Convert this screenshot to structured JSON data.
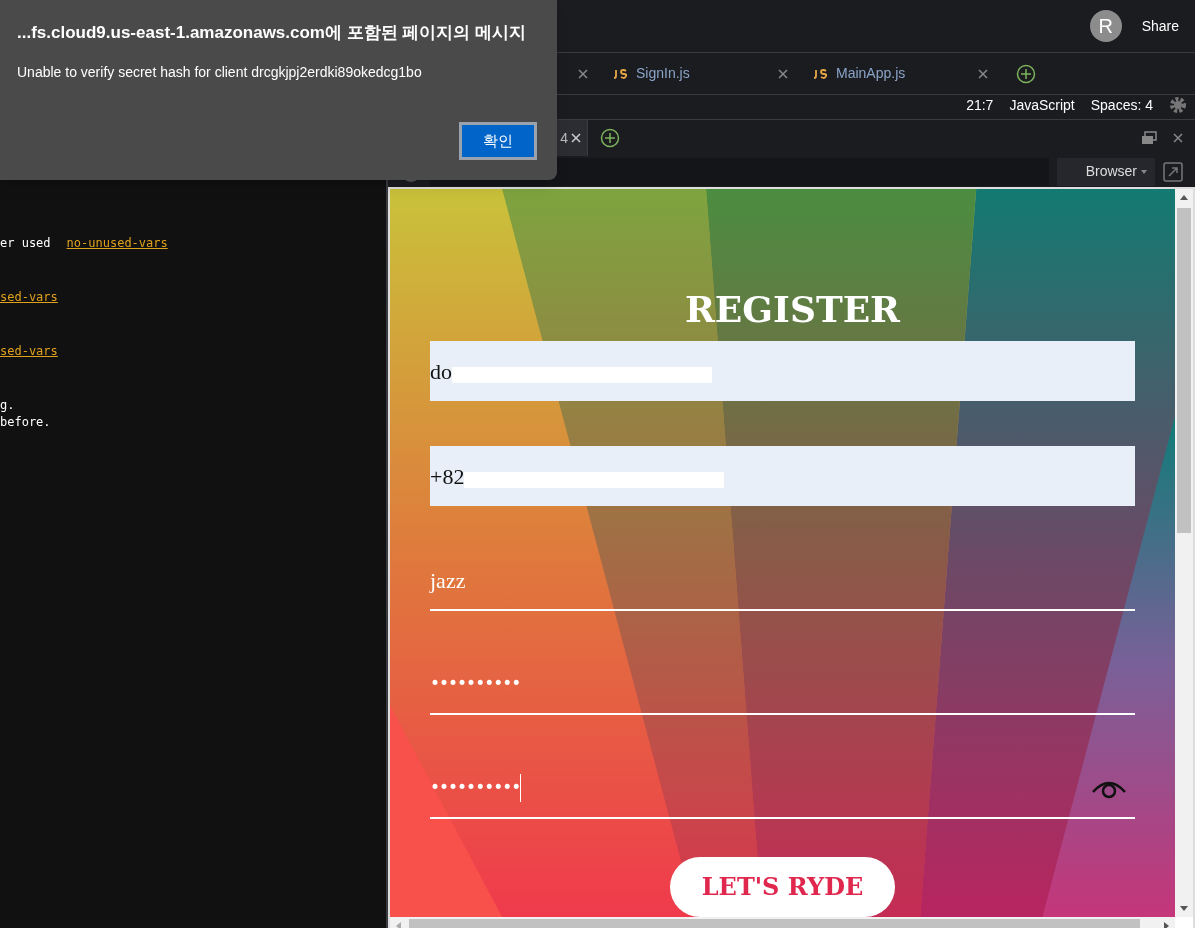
{
  "top_bar": {
    "avatar": "R",
    "share": "Share"
  },
  "editor_tabs": [
    {
      "selected": false
    },
    {
      "label": "SignIn.js",
      "selected": false
    },
    {
      "label": "MainApp.js",
      "selected": false
    }
  ],
  "status_bar": {
    "position": "21:7",
    "language": "JavaScript",
    "indent": "Spaces: 4"
  },
  "console_lines": [
    {
      "text": "er used",
      "link": "no-unused-vars"
    },
    {
      "link": "sed-vars"
    },
    {
      "link": "sed-vars"
    },
    {
      "text": "g."
    },
    {
      "text": "before."
    }
  ],
  "preview_tabs": [
    {
      "label": "4",
      "selected": true
    }
  ],
  "browser_bar": {
    "mode": "Browser"
  },
  "form": {
    "title": "REGISTER",
    "fields": [
      {
        "kind": "filled",
        "value": "do",
        "redacted": true
      },
      {
        "kind": "filled",
        "value": "+82",
        "redacted": true
      },
      {
        "kind": "line",
        "value": "jazz"
      },
      {
        "kind": "password",
        "value": "••••••••••"
      },
      {
        "kind": "password",
        "value": "••••••••••",
        "focused": true,
        "reveal_icon": true
      }
    ],
    "submit": "LET'S RYDE"
  },
  "dialog": {
    "title": "...fs.cloud9.us-east-1.amazonaws.com에 포함된 페이지의 메시지",
    "message": "Unable to verify secret hash for client drcgkjpj2erdki89okedcg1bo",
    "ok": "확인"
  }
}
